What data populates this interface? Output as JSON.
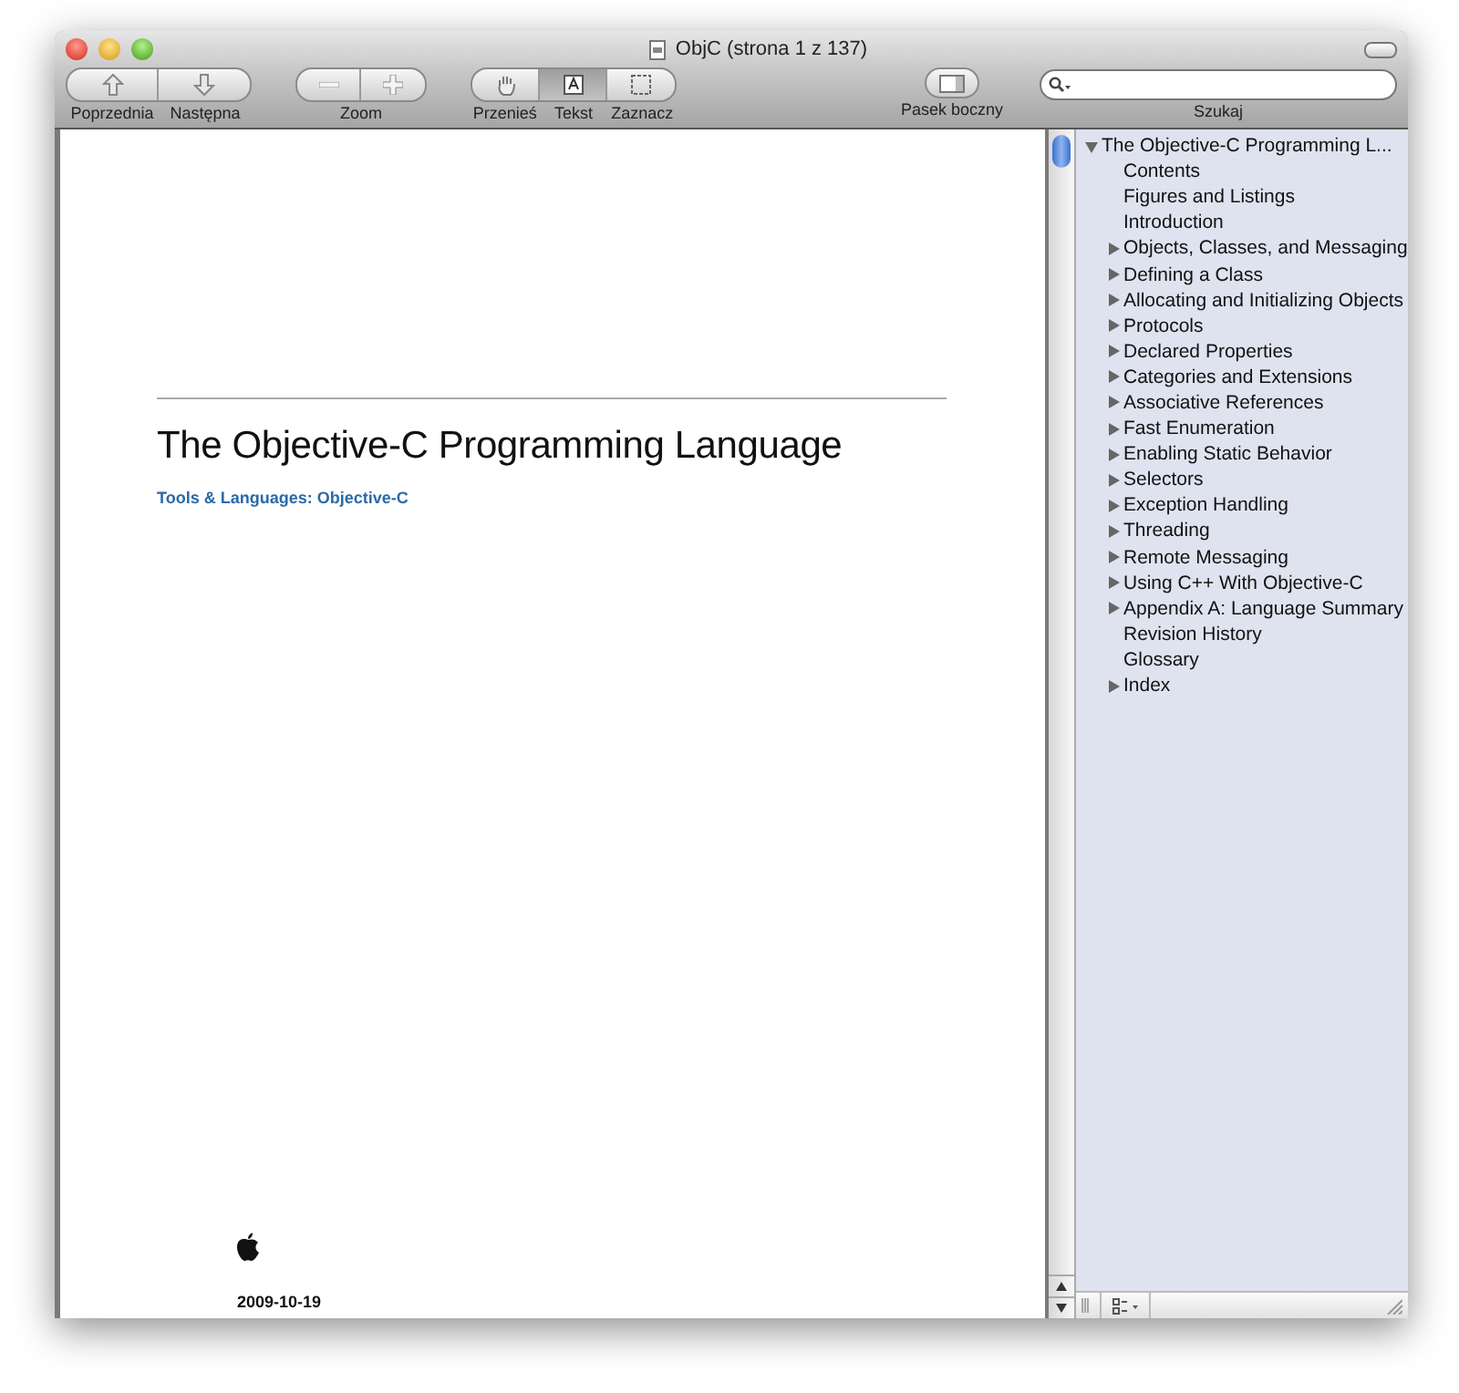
{
  "window": {
    "title": "ObjC (strona 1 z 137)"
  },
  "toolbar": {
    "groups": [
      {
        "kind": "nav",
        "items": [
          {
            "label": "Poprzednia",
            "selected": false
          },
          {
            "label": "Następna",
            "selected": false
          }
        ]
      },
      {
        "kind": "zoom",
        "label": "Zoom",
        "items": [
          {
            "selected": false
          },
          {
            "selected": false
          }
        ]
      },
      {
        "kind": "tools",
        "items": [
          {
            "label": "Przenieś",
            "selected": false
          },
          {
            "label": "Tekst",
            "selected": true
          },
          {
            "label": "Zaznacz",
            "selected": false
          }
        ]
      }
    ],
    "sidebar_button": {
      "label": "Pasek boczny"
    },
    "search": {
      "label": "Szukaj"
    }
  },
  "document": {
    "title": "The Objective-C Programming Language",
    "subtitle": "Tools & Languages: Objective-C",
    "date": "2009-10-19"
  },
  "sidebar": {
    "items": [
      {
        "label": "The Objective-C Programming L...",
        "expanded": true,
        "children": [
          {
            "label": "Contents",
            "expandable": false
          },
          {
            "label": "Figures and Listings",
            "expandable": false
          },
          {
            "label": "Introduction",
            "expandable": false
          },
          {
            "label": "Objects, Classes, and Messaging",
            "expandable": true
          },
          {
            "label": "Defining a Class",
            "expandable": true
          },
          {
            "label": "Allocating and Initializing Objects",
            "expandable": true
          },
          {
            "label": "Protocols",
            "expandable": true
          },
          {
            "label": "Declared Properties",
            "expandable": true
          },
          {
            "label": "Categories and Extensions",
            "expandable": true
          },
          {
            "label": "Associative References",
            "expandable": true
          },
          {
            "label": "Fast Enumeration",
            "expandable": true
          },
          {
            "label": "Enabling Static Behavior",
            "expandable": true
          },
          {
            "label": "Selectors",
            "expandable": true
          },
          {
            "label": "Exception Handling",
            "expandable": true
          },
          {
            "label": "Threading",
            "expandable": true
          },
          {
            "label": "Remote Messaging",
            "expandable": true
          },
          {
            "label": "Using C++ With Objective-C",
            "expandable": true
          },
          {
            "label": "Appendix A: Language Summary",
            "expandable": true
          },
          {
            "label": "Revision History",
            "expandable": false
          },
          {
            "label": "Glossary",
            "expandable": false
          },
          {
            "label": "Index",
            "expandable": true
          }
        ]
      }
    ]
  }
}
